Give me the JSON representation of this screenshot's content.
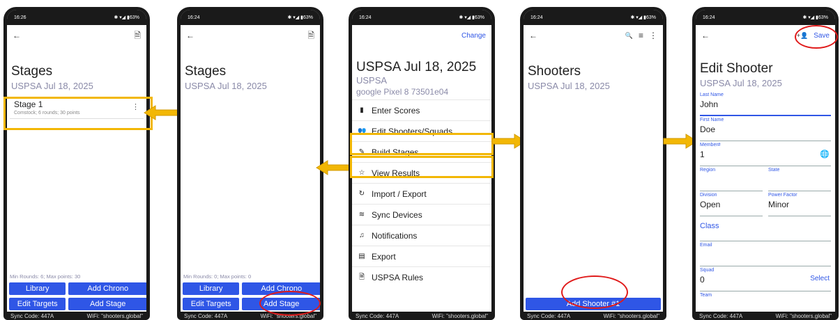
{
  "status": {
    "s1": {
      "time": "16:26",
      "right": "63%"
    },
    "s2": {
      "time": "16:24",
      "right": "63%"
    },
    "s3": {
      "time": "16:24",
      "right": "63%"
    },
    "s4": {
      "time": "16:24",
      "right": "63%"
    },
    "s5": {
      "time": "16:24",
      "right": "63%"
    }
  },
  "sync": {
    "code": "Sync Code: 447A",
    "wifi": "WiFi: \"shooters.global\""
  },
  "screen1": {
    "title": "Stages",
    "subtitle": "USPSA Jul 18, 2025",
    "stage_name": "Stage 1",
    "stage_detail": "Comstock; 6 rounds; 30 points",
    "footer": "Min Rounds: 6; Max points: 30",
    "buttons": [
      "Library",
      "Add Chrono",
      "Edit Targets",
      "Add Stage"
    ]
  },
  "screen2": {
    "title": "Stages",
    "subtitle": "USPSA Jul 18, 2025",
    "footer": "Min Rounds: 0; Max points: 0",
    "buttons": [
      "Library",
      "Add Chrono",
      "Edit Targets",
      "Add Stage"
    ]
  },
  "screen3": {
    "change": "Change",
    "title": "USPSA Jul 18, 2025",
    "org": "USPSA",
    "device": "google Pixel 8 73501e04",
    "menu": [
      "Enter Scores",
      "Edit Shooters/Squads",
      "Build Stages",
      "View Results",
      "Import / Export",
      "Sync Devices",
      "Notifications",
      "Export",
      "USPSA Rules"
    ]
  },
  "screen4": {
    "title": "Shooters",
    "subtitle": "USPSA Jul 18, 2025",
    "add_button": "Add Shooter #1"
  },
  "screen5": {
    "save": "Save",
    "title": "Edit Shooter",
    "subtitle": "USPSA Jul 18, 2025",
    "fields": {
      "last_name_label": "Last Name",
      "last_name": "John",
      "first_name_label": "First Name",
      "first_name": "Doe",
      "member_label": "Member#",
      "member": "1",
      "region_label": "Region",
      "state_label": "State",
      "division_label": "Division",
      "division": "Open",
      "power_label": "Power Factor",
      "power": "Minor",
      "class_label": "Class",
      "email_label": "Email",
      "squad_label": "Squad",
      "squad": "0",
      "squad_action": "Select",
      "team_label": "Team"
    }
  },
  "icons": {
    "back": "back-arrow-icon",
    "doc": "document-icon",
    "search": "search-icon",
    "sort": "sort-icon",
    "more": "more-vert-icon",
    "add_person": "person-add-icon",
    "globe": "globe-icon"
  },
  "colors": {
    "accent": "#2f56e6",
    "highlight": "#f2b705",
    "ring": "#e01b1b"
  }
}
